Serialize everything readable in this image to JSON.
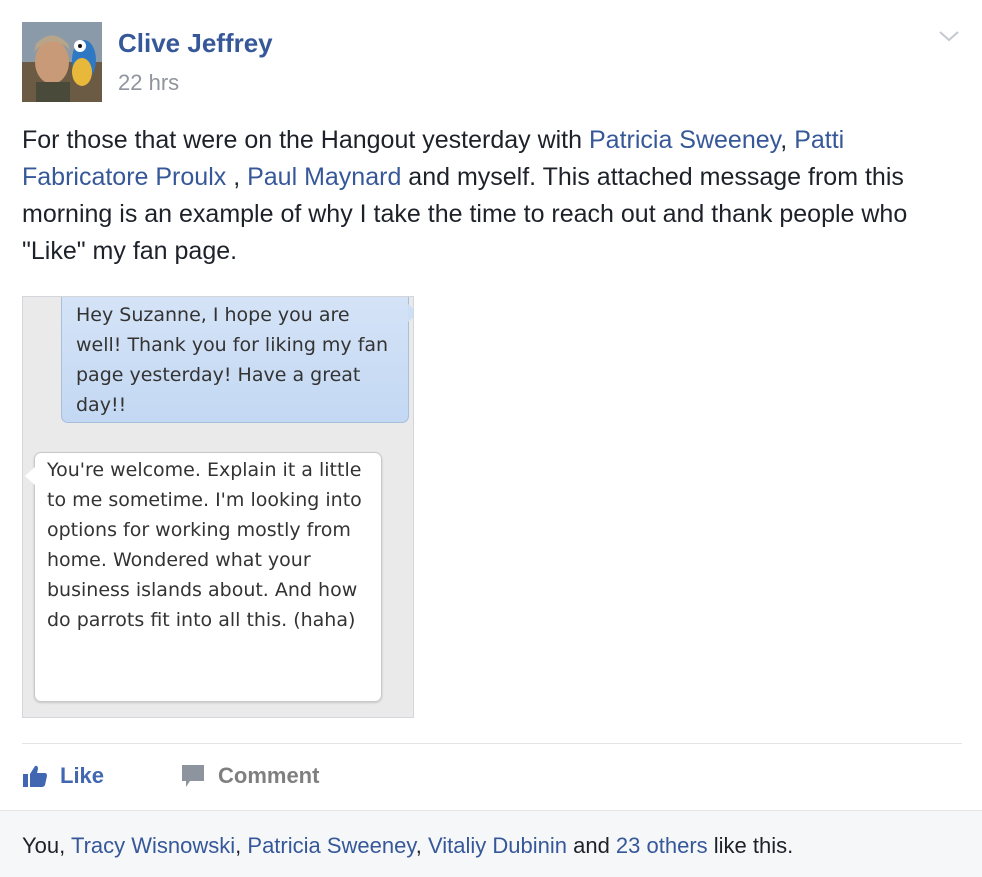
{
  "post": {
    "author": "Clive Jeffrey",
    "timestamp": "22 hrs",
    "text": {
      "part1": "For those that were on the Hangout yesterday with ",
      "mention1": "Patricia Sweeney",
      "sep1": ", ",
      "mention2": "Patti Fabricatore Proulx",
      "sep2": " , ",
      "mention3": "Paul Maynard",
      "part2": " and myself. This attached message from this morning is an example of why I take the time to reach out and thank people who \"Like\" my fan page."
    }
  },
  "attachment": {
    "message_sent": "Hey Suzanne, I hope you are well! Thank you for liking my fan page yesterday! Have a great day!!",
    "message_received": "You're welcome.  Explain it a little to me sometime. I'm looking into options for working mostly from home. Wondered what your business islands about.  And how do parrots fit into all this. (haha)"
  },
  "actions": {
    "like_label": "Like",
    "comment_label": "Comment"
  },
  "likes": {
    "you": "You, ",
    "liker1": "Tracy Wisnowski",
    "sep1": ", ",
    "liker2": "Patricia Sweeney",
    "sep2": ", ",
    "liker3": "Vitaliy Dubinin",
    "and": " and ",
    "others": "23 others",
    "suffix": " like this."
  },
  "colors": {
    "link": "#365899",
    "like_blue": "#4267b2",
    "meta_gray": "#90949c"
  },
  "icons": [
    "chevron-down-icon",
    "thumbs-up-icon",
    "comment-icon"
  ]
}
